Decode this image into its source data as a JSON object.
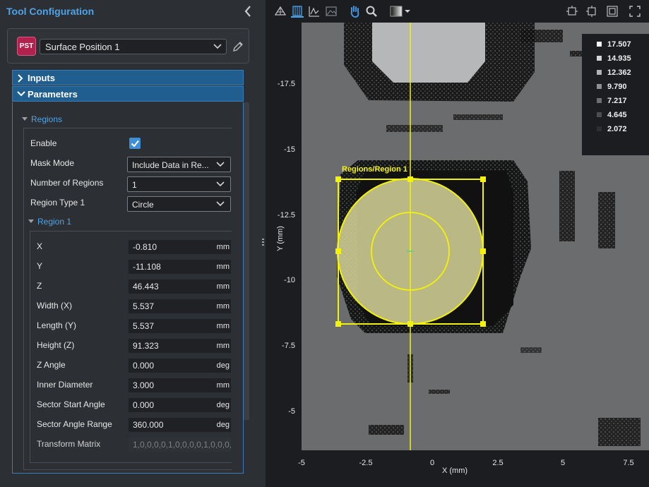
{
  "panel": {
    "title": "Tool Configuration",
    "tool_badge": "PST",
    "tool_name": "Surface Position 1",
    "accent": "#4fa3e8",
    "badge_color": "#b3214f"
  },
  "sections": {
    "inputs": "Inputs",
    "parameters": "Parameters"
  },
  "regions": {
    "heading": "Regions",
    "enable_label": "Enable",
    "enable_checked": true,
    "mask_mode_label": "Mask Mode",
    "mask_mode_value": "Include Data in Re...",
    "num_regions_label": "Number of Regions",
    "num_regions_value": "1",
    "region_type_label": "Region Type 1",
    "region_type_value": "Circle"
  },
  "region1": {
    "heading": "Region 1",
    "fields": [
      {
        "label": "X",
        "value": "-0.810",
        "unit": "mm"
      },
      {
        "label": "Y",
        "value": "-11.108",
        "unit": "mm"
      },
      {
        "label": "Z",
        "value": "46.443",
        "unit": "mm"
      },
      {
        "label": "Width (X)",
        "value": "5.537",
        "unit": "mm"
      },
      {
        "label": "Length (Y)",
        "value": "5.537",
        "unit": "mm"
      },
      {
        "label": "Height (Z)",
        "value": "91.323",
        "unit": "mm"
      },
      {
        "label": "Z Angle",
        "value": "0.000",
        "unit": "deg"
      },
      {
        "label": "Inner Diameter",
        "value": "3.000",
        "unit": "mm"
      },
      {
        "label": "Sector Start Angle",
        "value": "0.000",
        "unit": "deg"
      },
      {
        "label": "Sector Angle Range",
        "value": "360.000",
        "unit": "deg"
      },
      {
        "label": "Transform Matrix",
        "value": "1,0,0,0,0,1,0,0,0,0,1,0,0,0,0",
        "unit": ""
      }
    ]
  },
  "toolbar": {
    "icons": [
      "3d-view-icon",
      "heightmap-view-icon",
      "profile-view-icon",
      "image-view-icon",
      "pan-hand-icon",
      "zoom-icon",
      "colormap-icon",
      "fit-width-icon",
      "fit-height-icon",
      "fit-all-icon",
      "fullscreen-icon"
    ]
  },
  "viewer": {
    "x_label": "X (mm)",
    "y_label": "Y (mm)",
    "x_ticks": [
      "-5",
      "-2.5",
      "0",
      "2.5",
      "5",
      "7.5"
    ],
    "y_ticks": [
      "-17.5",
      "-15",
      "-12.5",
      "-10",
      "-7.5",
      "-5"
    ],
    "region_label": "Regions/Region 1",
    "region_color": "#f2f20a",
    "legend": [
      {
        "value": "17.507",
        "color": "#f4f4f4"
      },
      {
        "value": "14.935",
        "color": "#d6d6d6"
      },
      {
        "value": "12.362",
        "color": "#b3b3b3"
      },
      {
        "value": "9.790",
        "color": "#909090"
      },
      {
        "value": "7.217",
        "color": "#6e6e6e"
      },
      {
        "value": "4.645",
        "color": "#4d4d4d"
      },
      {
        "value": "2.072",
        "color": "#2e2e2e"
      }
    ]
  }
}
